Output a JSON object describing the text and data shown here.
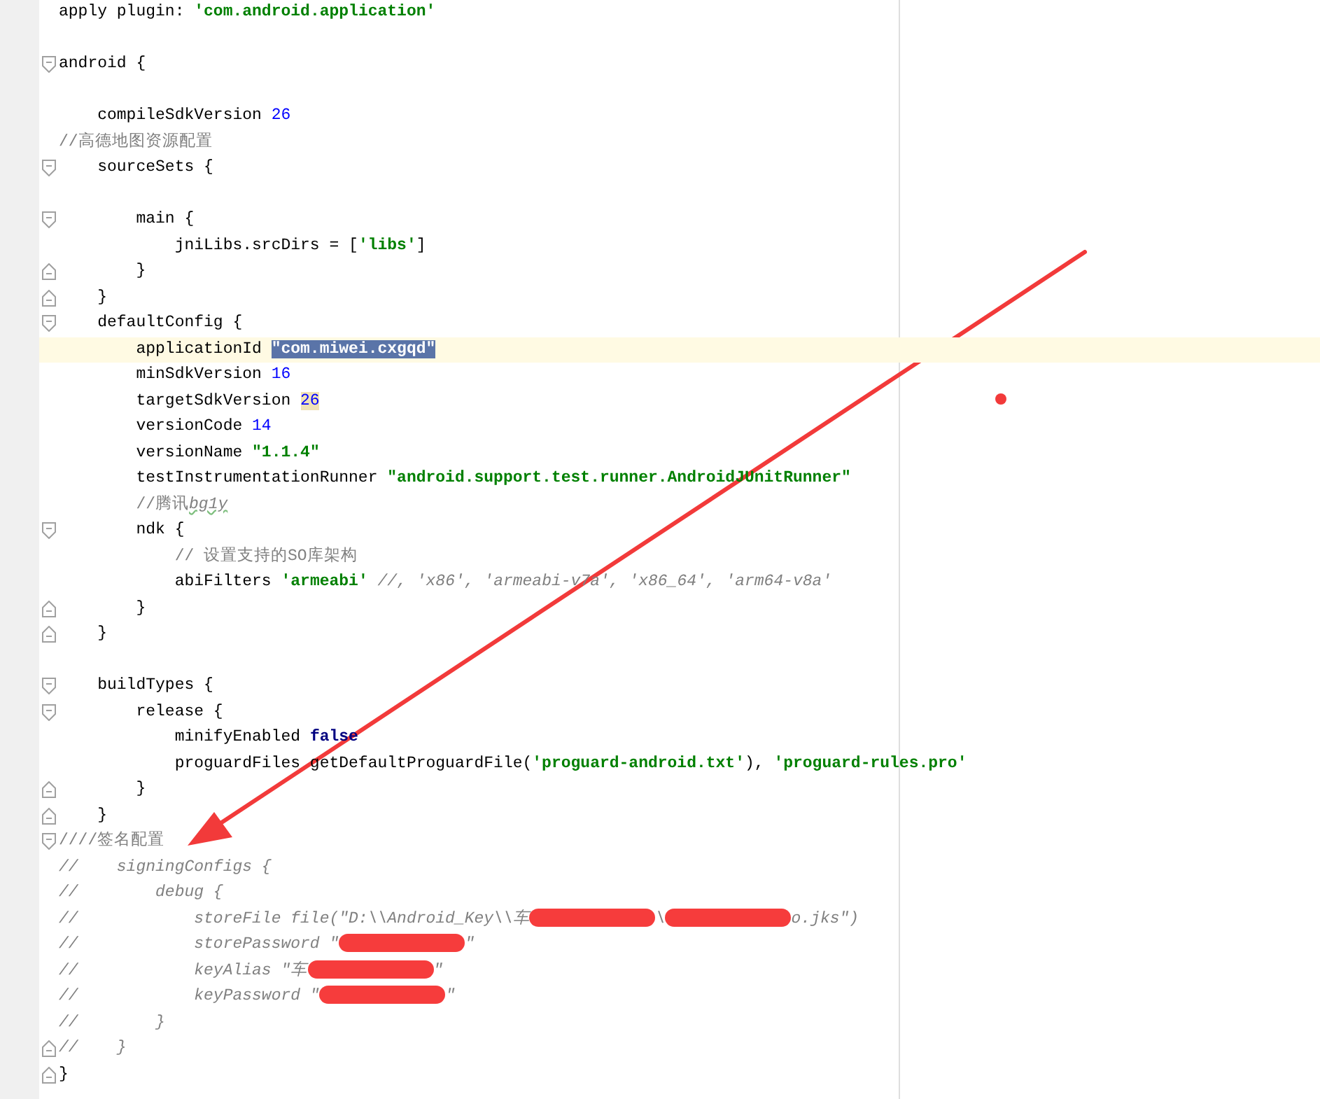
{
  "editor": {
    "lines": [
      {
        "kind": "plain",
        "current": false,
        "tokens": [
          {
            "kind": "plain",
            "text": "apply plugin: "
          },
          {
            "kind": "string",
            "text": "'com.android.application'"
          }
        ]
      },
      {
        "kind": "plain",
        "current": false
      },
      {
        "kind": "fold_start",
        "current": false,
        "tokens": [
          {
            "kind": "plain",
            "text": "android {"
          }
        ]
      },
      {
        "kind": "plain",
        "current": false
      },
      {
        "kind": "plain",
        "current": false,
        "tokens": [
          {
            "kind": "plain",
            "text": "    compileSdkVersion "
          },
          {
            "kind": "number",
            "text": "26"
          }
        ]
      },
      {
        "kind": "plain",
        "current": false,
        "tokens": [
          {
            "kind": "comment_plain",
            "text": "//高德地图资源配置"
          }
        ]
      },
      {
        "kind": "fold_start",
        "current": false,
        "tokens": [
          {
            "kind": "plain",
            "text": "    sourceSets {"
          }
        ]
      },
      {
        "kind": "plain",
        "current": false
      },
      {
        "kind": "fold_start",
        "current": false,
        "tokens": [
          {
            "kind": "plain",
            "text": "        main {"
          }
        ]
      },
      {
        "kind": "plain",
        "current": false,
        "tokens": [
          {
            "kind": "plain",
            "text": "            jniLibs.srcDirs = ["
          },
          {
            "kind": "string",
            "text": "'libs'"
          },
          {
            "kind": "plain",
            "text": "]"
          }
        ]
      },
      {
        "kind": "fold_end",
        "current": false,
        "tokens": [
          {
            "kind": "plain",
            "text": "        }"
          }
        ]
      },
      {
        "kind": "fold_end",
        "current": false,
        "tokens": [
          {
            "kind": "plain",
            "text": "    }"
          }
        ]
      },
      {
        "kind": "fold_start",
        "current": false,
        "tokens": [
          {
            "kind": "plain",
            "text": "    defaultConfig {"
          }
        ]
      },
      {
        "kind": "plain",
        "current": true,
        "tokens": [
          {
            "kind": "plain",
            "text": "        applicationId "
          },
          {
            "kind": "string_selected",
            "text": "\"com.miwei.cxgqd\""
          }
        ]
      },
      {
        "kind": "plain",
        "current": false,
        "tokens": [
          {
            "kind": "plain",
            "text": "        minSdkVersion "
          },
          {
            "kind": "number",
            "text": "16"
          }
        ]
      },
      {
        "kind": "plain",
        "current": false,
        "tokens": [
          {
            "kind": "plain",
            "text": "        targetSdkVersion "
          },
          {
            "kind": "number_match",
            "text": "26"
          }
        ]
      },
      {
        "kind": "plain",
        "current": false,
        "tokens": [
          {
            "kind": "plain",
            "text": "        versionCode "
          },
          {
            "kind": "number",
            "text": "14"
          }
        ]
      },
      {
        "kind": "plain",
        "current": false,
        "tokens": [
          {
            "kind": "plain",
            "text": "        versionName "
          },
          {
            "kind": "string",
            "text": "\"1.1.4\""
          }
        ]
      },
      {
        "kind": "plain",
        "current": false,
        "tokens": [
          {
            "kind": "plain",
            "text": "        testInstrumentationRunner "
          },
          {
            "kind": "string",
            "text": "\"android.support.test.runner.AndroidJUnitRunner\""
          }
        ]
      },
      {
        "kind": "plain",
        "current": false,
        "tokens": [
          {
            "kind": "comment_plain",
            "text": "        //腾讯"
          },
          {
            "kind": "comment_typo",
            "text": "bg1y"
          }
        ]
      },
      {
        "kind": "fold_start",
        "current": false,
        "tokens": [
          {
            "kind": "plain",
            "text": "        ndk {"
          }
        ]
      },
      {
        "kind": "plain",
        "current": false,
        "tokens": [
          {
            "kind": "comment_plain",
            "text": "            // 设置支持的SO库架构"
          }
        ]
      },
      {
        "kind": "plain",
        "current": false,
        "tokens": [
          {
            "kind": "plain",
            "text": "            abiFilters "
          },
          {
            "kind": "string",
            "text": "'armeabi'"
          },
          {
            "kind": "comment",
            "text": " //, 'x86', 'armeabi-v7a', 'x86_64', 'arm64-v8a'"
          }
        ]
      },
      {
        "kind": "fold_end",
        "current": false,
        "tokens": [
          {
            "kind": "plain",
            "text": "        }"
          }
        ]
      },
      {
        "kind": "fold_end",
        "current": false,
        "tokens": [
          {
            "kind": "plain",
            "text": "    }"
          }
        ]
      },
      {
        "kind": "plain",
        "current": false
      },
      {
        "kind": "fold_start",
        "current": false,
        "tokens": [
          {
            "kind": "plain",
            "text": "    buildTypes {"
          }
        ]
      },
      {
        "kind": "fold_start",
        "current": false,
        "tokens": [
          {
            "kind": "plain",
            "text": "        release {"
          }
        ]
      },
      {
        "kind": "plain",
        "current": false,
        "tokens": [
          {
            "kind": "plain",
            "text": "            minifyEnabled "
          },
          {
            "kind": "keyword",
            "text": "false"
          }
        ]
      },
      {
        "kind": "plain",
        "current": false,
        "tokens": [
          {
            "kind": "plain",
            "text": "            proguardFiles getDefaultProguardFile("
          },
          {
            "kind": "string",
            "text": "'proguard-android.txt'"
          },
          {
            "kind": "plain",
            "text": "), "
          },
          {
            "kind": "string",
            "text": "'proguard-rules.pro'"
          }
        ]
      },
      {
        "kind": "fold_end",
        "current": false,
        "tokens": [
          {
            "kind": "plain",
            "text": "        }"
          }
        ]
      },
      {
        "kind": "fold_end",
        "current": false,
        "tokens": [
          {
            "kind": "plain",
            "text": "    }"
          }
        ]
      },
      {
        "kind": "fold_start",
        "current": false,
        "tokens": [
          {
            "kind": "comment_plain",
            "text": "////签名配置"
          }
        ]
      },
      {
        "kind": "plain",
        "current": false,
        "tokens": [
          {
            "kind": "comment",
            "text": "//    signingConfigs {"
          }
        ]
      },
      {
        "kind": "plain",
        "current": false,
        "tokens": [
          {
            "kind": "comment",
            "text": "//        debug {"
          }
        ]
      },
      {
        "kind": "plain",
        "current": false,
        "tokens": [
          {
            "kind": "comment",
            "text": "//            storeFile file(\"D:\\\\Android_Key\\\\车"
          },
          {
            "kind": "redaction"
          },
          {
            "kind": "comment",
            "text": "\\"
          },
          {
            "kind": "redaction"
          },
          {
            "kind": "comment",
            "text": "o.jks\")"
          }
        ]
      },
      {
        "kind": "plain",
        "current": false,
        "tokens": [
          {
            "kind": "comment",
            "text": "//            storePassword \""
          },
          {
            "kind": "redaction"
          },
          {
            "kind": "comment",
            "text": "\""
          }
        ]
      },
      {
        "kind": "plain",
        "current": false,
        "tokens": [
          {
            "kind": "comment",
            "text": "//            keyAlias \"车"
          },
          {
            "kind": "redaction"
          },
          {
            "kind": "comment",
            "text": "\""
          }
        ]
      },
      {
        "kind": "plain",
        "current": false,
        "tokens": [
          {
            "kind": "comment",
            "text": "//            keyPassword \""
          },
          {
            "kind": "redaction"
          },
          {
            "kind": "comment",
            "text": "\""
          }
        ]
      },
      {
        "kind": "plain",
        "current": false,
        "tokens": [
          {
            "kind": "comment",
            "text": "//        }"
          }
        ]
      },
      {
        "kind": "fold_end",
        "current": false,
        "tokens": [
          {
            "kind": "comment",
            "text": "//    }"
          }
        ]
      },
      {
        "kind": "fold_end",
        "current": false,
        "tokens": [
          {
            "kind": "plain",
            "text": "}"
          }
        ]
      }
    ]
  }
}
